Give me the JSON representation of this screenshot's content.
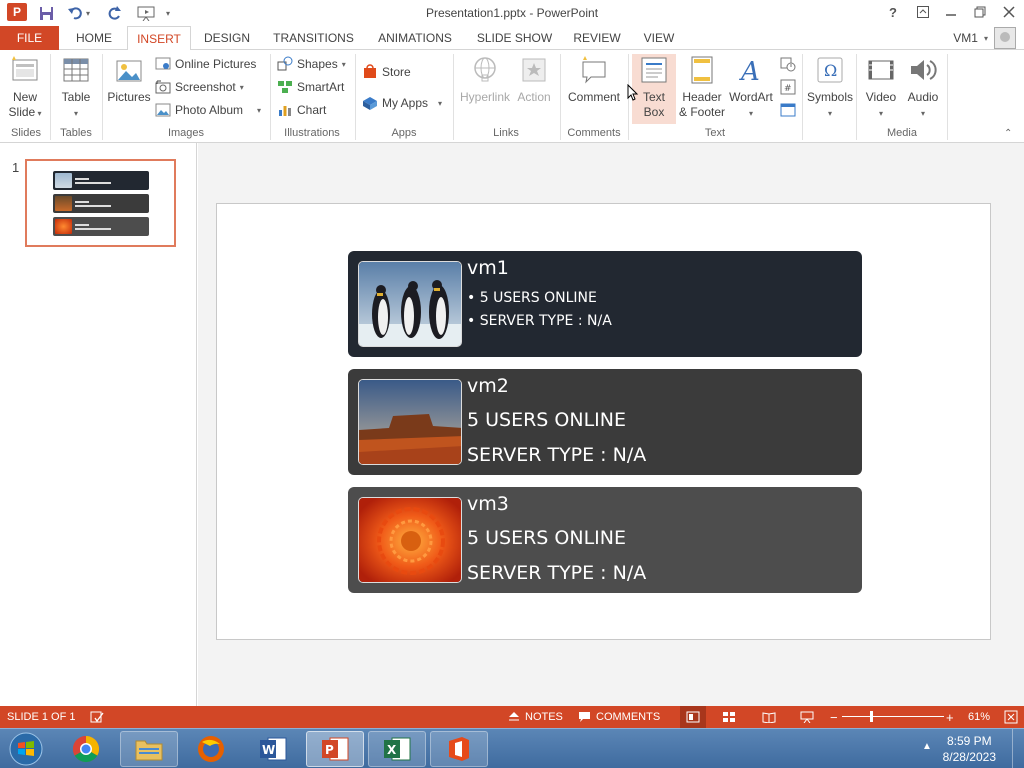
{
  "window": {
    "title": "Presentation1.pptx - PowerPoint",
    "app_icon": "P"
  },
  "tabs": {
    "file": "FILE",
    "home": "HOME",
    "insert": "INSERT",
    "design": "DESIGN",
    "transitions": "TRANSITIONS",
    "animations": "ANIMATIONS",
    "slideshow": "SLIDE SHOW",
    "review": "REVIEW",
    "view": "VIEW",
    "user": "VM1"
  },
  "ribbon": {
    "slides": {
      "new_slide": "New",
      "new_slide2": "Slide",
      "label": "Slides"
    },
    "tables": {
      "table": "Table",
      "label": "Tables"
    },
    "images": {
      "pictures": "Pictures",
      "online_pictures": "Online Pictures",
      "screenshot": "Screenshot",
      "photo_album": "Photo Album",
      "label": "Images"
    },
    "illustrations": {
      "shapes": "Shapes",
      "smartart": "SmartArt",
      "chart": "Chart",
      "label": "Illustrations"
    },
    "apps": {
      "store": "Store",
      "my_apps": "My Apps",
      "label": "Apps"
    },
    "links": {
      "hyperlink": "Hyperlink",
      "action": "Action",
      "label": "Links"
    },
    "comments": {
      "comment": "Comment",
      "label": "Comments"
    },
    "text": {
      "textbox1": "Text",
      "textbox2": "Box",
      "header1": "Header",
      "header2": "& Footer",
      "wordart": "WordArt",
      "label": "Text"
    },
    "symbols": {
      "symbols": "Symbols"
    },
    "media": {
      "video": "Video",
      "audio": "Audio",
      "label": "Media"
    }
  },
  "thumbnails": {
    "slide_number": "1"
  },
  "slide": {
    "cards": [
      {
        "name": "vm1",
        "line1": "• 5 USERS ONLINE",
        "line2": "• SERVER TYPE : N/A",
        "bg": "#222831",
        "image": "penguins"
      },
      {
        "name": "vm2",
        "line1": "5 USERS ONLINE",
        "line2": "SERVER TYPE : N/A",
        "bg": "#3b3b3b",
        "image": "desert"
      },
      {
        "name": "vm3",
        "line1": "5 USERS ONLINE",
        "line2": "SERVER TYPE : N/A",
        "bg": "#4d4d4d",
        "image": "chrysanthemum"
      }
    ]
  },
  "statusbar": {
    "slide_info": "SLIDE 1 OF 1",
    "notes": "NOTES",
    "comments": "COMMENTS",
    "zoom": "61%"
  },
  "taskbar": {
    "time": "8:59 PM",
    "date": "8/28/2023"
  },
  "colors": {
    "accent": "#d24726"
  }
}
